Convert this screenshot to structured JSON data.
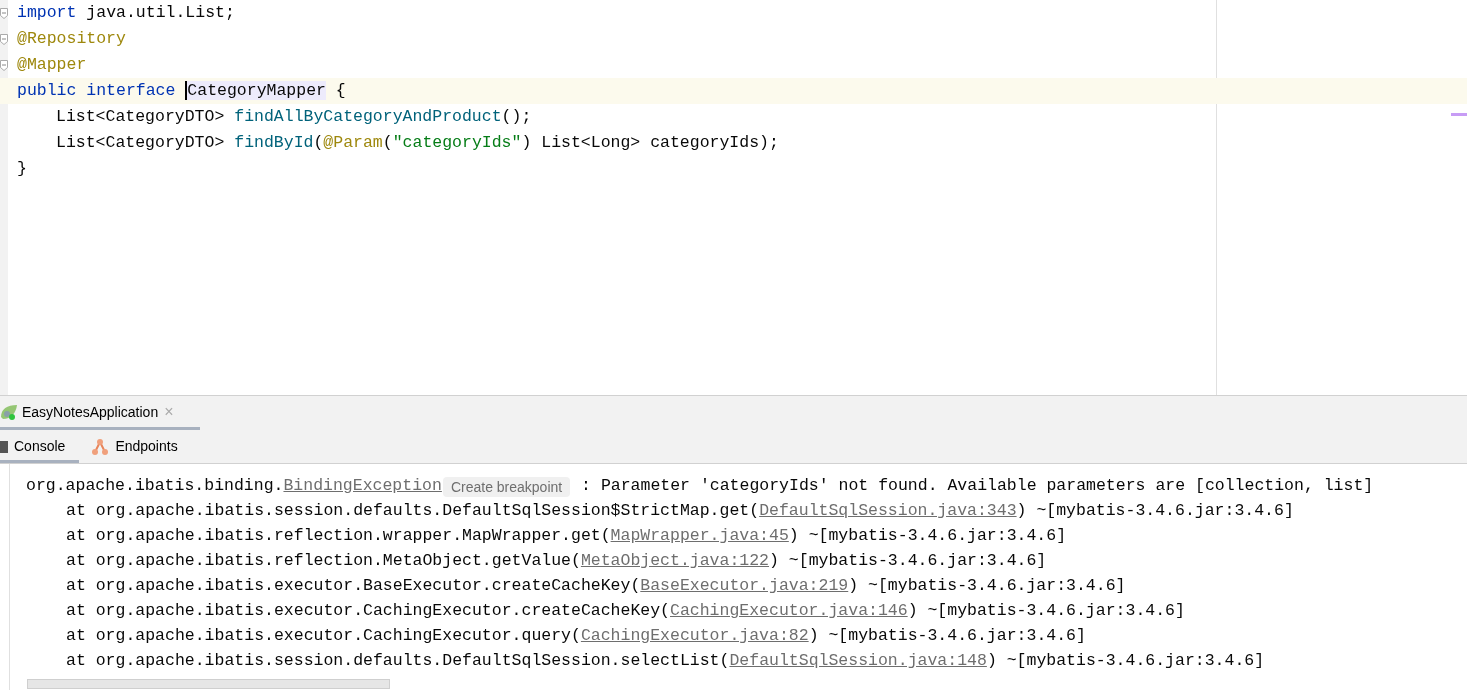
{
  "editor": {
    "lines": [
      {
        "tokens": [
          {
            "kind": "keyword",
            "text": "import"
          },
          {
            "kind": "plain",
            "text": " java.util.List;"
          }
        ],
        "current": false,
        "fold": true
      },
      {
        "tokens": [
          {
            "kind": "annotation",
            "text": "@Repository"
          }
        ],
        "current": false,
        "fold": true
      },
      {
        "tokens": [
          {
            "kind": "annotation",
            "text": "@Mapper"
          }
        ],
        "current": false,
        "fold": true
      },
      {
        "tokens": [
          {
            "kind": "keyword",
            "text": "public interface "
          },
          {
            "kind": "caret",
            "text": "CategoryMapper"
          },
          {
            "kind": "plain",
            "text": " {"
          }
        ],
        "current": true,
        "fold": false,
        "children": [
          {
            "tokens": [
              {
                "kind": "plain",
                "text": "List<CategoryDTO> "
              },
              {
                "kind": "method",
                "text": "findAllByCategoryAndProduct"
              },
              {
                "kind": "plain",
                "text": "();"
              }
            ],
            "current": false,
            "fold": false
          },
          {
            "tokens": [
              {
                "kind": "plain",
                "text": "List<CategoryDTO> "
              },
              {
                "kind": "method",
                "text": "findById"
              },
              {
                "kind": "plain",
                "text": "("
              },
              {
                "kind": "annotation",
                "text": "@Param"
              },
              {
                "kind": "plain",
                "text": "("
              },
              {
                "kind": "string",
                "text": "\"categoryIds\""
              },
              {
                "kind": "plain",
                "text": ") List<Long> categoryIds);"
              }
            ],
            "current": false,
            "fold": false
          }
        ]
      },
      {
        "tokens": [
          {
            "kind": "plain",
            "text": "}"
          }
        ],
        "current": false,
        "fold": false
      }
    ]
  },
  "run_tab": {
    "label": "EasyNotesApplication",
    "close": "×"
  },
  "console_tabs": [
    {
      "label": "Console",
      "selected": true
    },
    {
      "label": "Endpoints",
      "selected": false
    }
  ],
  "console": {
    "lines": [
      {
        "kind": "exception",
        "tokens": [
          {
            "kind": "plain",
            "text": "org.apache.ibatis.binding."
          },
          {
            "kind": "link",
            "text": "BindingException"
          },
          {
            "kind": "hint",
            "text": "Create breakpoint"
          },
          {
            "kind": "plain",
            "text": " : Parameter 'categoryIds' not found. Available parameters are [collection, list]"
          }
        ]
      },
      {
        "kind": "frame",
        "tokens": [
          {
            "kind": "plain",
            "text": "at org.apache.ibatis.session.defaults.DefaultSqlSession$StrictMap.get("
          },
          {
            "kind": "link",
            "text": "DefaultSqlSession.java:343"
          },
          {
            "kind": "plain",
            "text": ") ~[mybatis-3.4.6.jar:3.4.6]"
          }
        ]
      },
      {
        "kind": "frame",
        "tokens": [
          {
            "kind": "plain",
            "text": "at org.apache.ibatis.reflection.wrapper.MapWrapper.get("
          },
          {
            "kind": "link",
            "text": "MapWrapper.java:45"
          },
          {
            "kind": "plain",
            "text": ") ~[mybatis-3.4.6.jar:3.4.6]"
          }
        ]
      },
      {
        "kind": "frame",
        "tokens": [
          {
            "kind": "plain",
            "text": "at org.apache.ibatis.reflection.MetaObject.getValue("
          },
          {
            "kind": "link",
            "text": "MetaObject.java:122"
          },
          {
            "kind": "plain",
            "text": ") ~[mybatis-3.4.6.jar:3.4.6]"
          }
        ]
      },
      {
        "kind": "frame",
        "tokens": [
          {
            "kind": "plain",
            "text": "at org.apache.ibatis.executor.BaseExecutor.createCacheKey("
          },
          {
            "kind": "link",
            "text": "BaseExecutor.java:219"
          },
          {
            "kind": "plain",
            "text": ") ~[mybatis-3.4.6.jar:3.4.6]"
          }
        ]
      },
      {
        "kind": "frame",
        "tokens": [
          {
            "kind": "plain",
            "text": "at org.apache.ibatis.executor.CachingExecutor.createCacheKey("
          },
          {
            "kind": "link",
            "text": "CachingExecutor.java:146"
          },
          {
            "kind": "plain",
            "text": ") ~[mybatis-3.4.6.jar:3.4.6]"
          }
        ]
      },
      {
        "kind": "frame",
        "tokens": [
          {
            "kind": "plain",
            "text": "at org.apache.ibatis.executor.CachingExecutor.query("
          },
          {
            "kind": "link",
            "text": "CachingExecutor.java:82"
          },
          {
            "kind": "plain",
            "text": ") ~[mybatis-3.4.6.jar:3.4.6]"
          }
        ]
      },
      {
        "kind": "frame",
        "tokens": [
          {
            "kind": "plain",
            "text": "at org.apache.ibatis.session.defaults.DefaultSqlSession.selectList("
          },
          {
            "kind": "link",
            "text": "DefaultSqlSession.java:148"
          },
          {
            "kind": "plain",
            "text": ") ~[mybatis-3.4.6.jar:3.4.6]"
          }
        ]
      }
    ]
  }
}
